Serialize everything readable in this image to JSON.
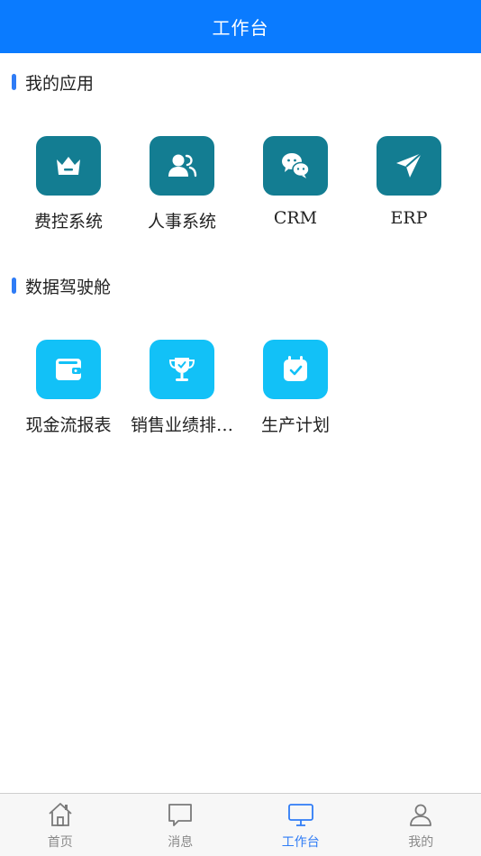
{
  "header": {
    "title": "工作台"
  },
  "sections": [
    {
      "title": "我的应用",
      "apps": [
        {
          "label": "费控系统",
          "icon": "crown-icon",
          "color": "#137d92"
        },
        {
          "label": "人事系统",
          "icon": "users-icon",
          "color": "#137d92"
        },
        {
          "label": "CRM",
          "icon": "wechat-icon",
          "color": "#137d92"
        },
        {
          "label": "ERP",
          "icon": "paper-plane-icon",
          "color": "#137d92"
        }
      ]
    },
    {
      "title": "数据驾驶舱",
      "apps": [
        {
          "label": "现金流报表",
          "icon": "wallet-icon",
          "color": "#12c1f7"
        },
        {
          "label": "销售业绩排…",
          "icon": "trophy-icon",
          "color": "#12c1f7"
        },
        {
          "label": "生产计划",
          "icon": "calendar-check-icon",
          "color": "#12c1f7"
        }
      ]
    }
  ],
  "tabbar": {
    "active": "工作台",
    "accent": "#2f7cf6",
    "items": [
      {
        "label": "首页",
        "icon": "home-icon"
      },
      {
        "label": "消息",
        "icon": "message-icon"
      },
      {
        "label": "工作台",
        "icon": "monitor-icon"
      },
      {
        "label": "我的",
        "icon": "person-icon"
      }
    ]
  }
}
